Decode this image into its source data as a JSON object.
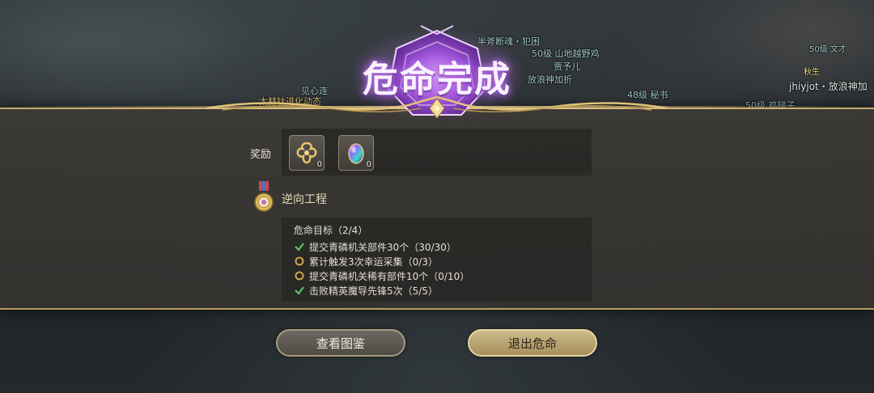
{
  "background_nameplates": [
    {
      "text": "半斧断魂・犯困"
    },
    {
      "text": "50级 山地越野鸡"
    },
    {
      "text": "贾予儿"
    },
    {
      "text": "放浪神加折"
    },
    {
      "text": "48级 秘书"
    },
    {
      "text": "50级 鸡腿子"
    },
    {
      "text": "50级 文才"
    },
    {
      "text": "秋生"
    },
    {
      "text": "jhiyjot・放浪神加"
    },
    {
      "text": "见心连"
    },
    {
      "text": "太赫钛进化动态"
    }
  ],
  "banner": {
    "title": "危命完成"
  },
  "rewards": {
    "label": "奖励",
    "items": [
      {
        "icon": "gold-flower-token-icon",
        "count": "0"
      },
      {
        "icon": "rainbow-gem-icon",
        "count": "0"
      }
    ]
  },
  "quest": {
    "name": "逆向工程",
    "goal_header": "危命目标（2/4）",
    "goals": [
      {
        "text": "提交青磷机关部件30个（30/30）",
        "status": "done",
        "icon": "check-icon"
      },
      {
        "text": "累计触发3次幸运采集（0/3）",
        "status": "pending",
        "icon": "ring-icon"
      },
      {
        "text": "提交青磷机关稀有部件10个（0/10）",
        "status": "pending",
        "icon": "ring-icon"
      },
      {
        "text": "击败精英魔导先锋5次（5/5）",
        "status": "done",
        "icon": "check-icon"
      }
    ]
  },
  "buttons": {
    "left_label": "查看图鉴",
    "right_label": "退出危命"
  },
  "colors": {
    "accent_gold": "#c5a86a",
    "emblem_purple": "#9b4fd8",
    "check_green": "#5ccf6a",
    "pending_gold": "#d9b14a"
  }
}
